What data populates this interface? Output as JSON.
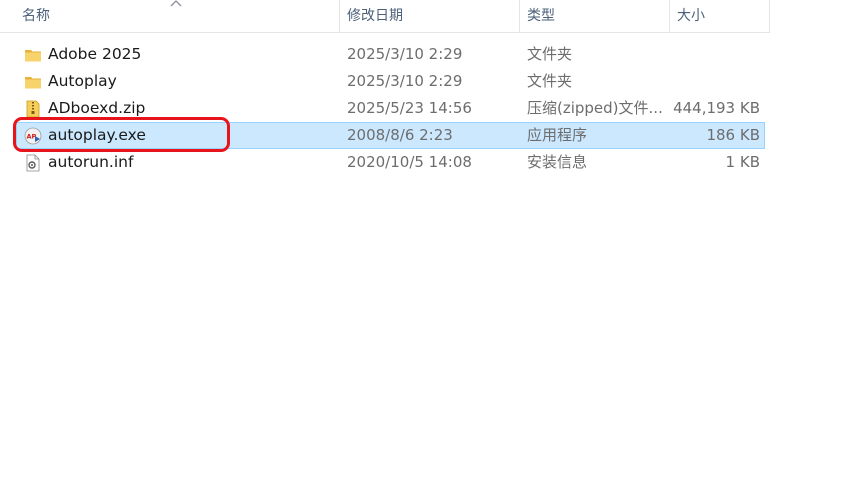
{
  "columns": {
    "name": "名称",
    "modified": "修改日期",
    "type": "类型",
    "size": "大小"
  },
  "files": [
    {
      "name": "Adobe 2025",
      "modified": "2025/3/10 2:29",
      "type": "文件夹",
      "size": "",
      "icon": "folder-icon",
      "selected": false
    },
    {
      "name": "Autoplay",
      "modified": "2025/3/10 2:29",
      "type": "文件夹",
      "size": "",
      "icon": "folder-icon",
      "selected": false
    },
    {
      "name": "ADboexd.zip",
      "modified": "2025/5/23 14:56",
      "type": "压缩(zipped)文件...",
      "size": "444,193 KB",
      "icon": "zip-archive-icon",
      "selected": false
    },
    {
      "name": "autoplay.exe",
      "modified": "2008/8/6 2:23",
      "type": "应用程序",
      "size": "186 KB",
      "icon": "application-exe-icon",
      "selected": true
    },
    {
      "name": "autorun.inf",
      "modified": "2020/10/5 14:08",
      "type": "安装信息",
      "size": "1 KB",
      "icon": "setup-info-file-icon",
      "selected": false
    }
  ],
  "colors": {
    "selection_bg": "#cce8ff",
    "selection_border": "#99d1ff",
    "annotation_red": "#e8141c",
    "folder_yellow": "#f4c542"
  }
}
